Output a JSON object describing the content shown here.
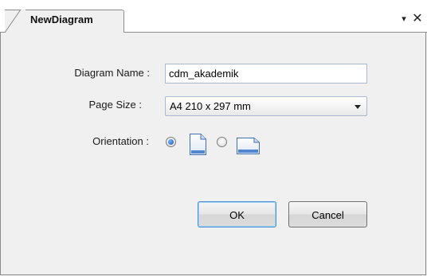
{
  "tab": {
    "title": "NewDiagram",
    "dropdown_glyph": "▾",
    "close_glyph": "✕"
  },
  "form": {
    "diagram_name": {
      "label": "Diagram Name :",
      "value": "cdm_akademik"
    },
    "page_size": {
      "label": "Page Size :",
      "selected": "A4 210 x 297 mm"
    },
    "orientation": {
      "label": "Orientation :",
      "options": [
        {
          "name": "portrait",
          "selected": true,
          "icon": "portrait-page-icon"
        },
        {
          "name": "landscape",
          "selected": false,
          "icon": "landscape-page-icon"
        }
      ]
    }
  },
  "buttons": {
    "ok_label": "OK",
    "cancel_label": "Cancel"
  },
  "colors": {
    "window_bg": "#f0f0f0",
    "input_border": "#a9b8cf",
    "radio_selected": "#1f4fa8",
    "ok_focus_border": "#4a8fd8"
  }
}
